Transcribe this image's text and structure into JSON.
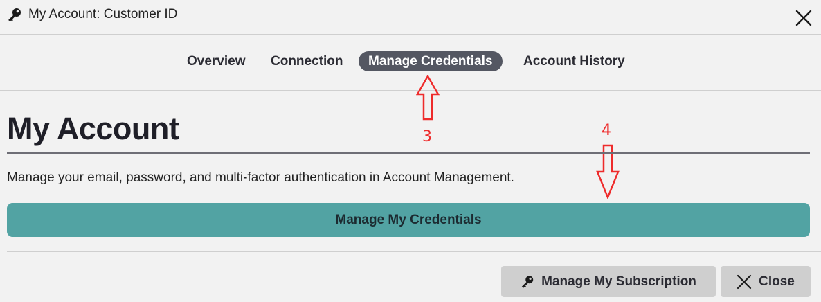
{
  "window": {
    "title": "My Account: Customer ID",
    "title_icon": "key-icon",
    "close_icon": "close-icon"
  },
  "tabs": [
    {
      "label": "Overview",
      "active": false
    },
    {
      "label": "Connection",
      "active": false
    },
    {
      "label": "Manage Credentials",
      "active": true
    },
    {
      "label": "Account History",
      "active": false
    }
  ],
  "main": {
    "heading": "My Account",
    "description": "Manage your email, password, and multi-factor authentication in Account Management.",
    "primary_button": "Manage My Credentials"
  },
  "footer": {
    "subscription_button": "Manage My Subscription",
    "subscription_icon": "key-icon",
    "close_button": "Close",
    "close_icon": "close-icon"
  },
  "annotations": {
    "step3": "3",
    "step4": "4",
    "color": "#ee2b2b"
  },
  "colors": {
    "active_tab": "#545762",
    "primary_button": "#52a3a3",
    "background": "#f2f2f2"
  }
}
